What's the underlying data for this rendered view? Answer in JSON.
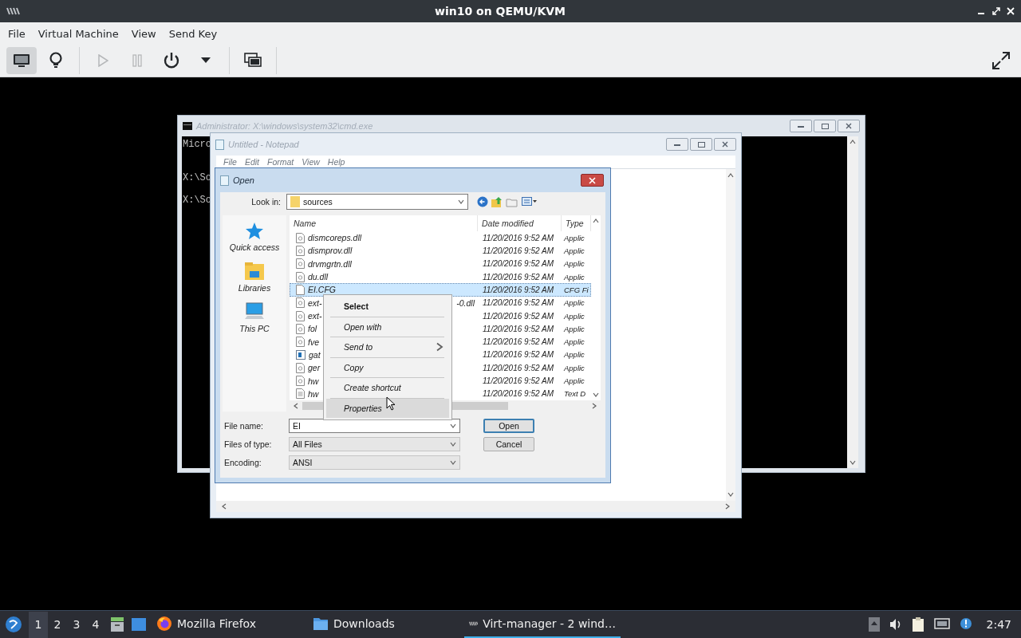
{
  "window": {
    "title": "win10 on QEMU/KVM"
  },
  "menu": [
    "File",
    "Virtual Machine",
    "View",
    "Send Key"
  ],
  "toolbar": [
    [
      {
        "kind": "monitor",
        "selected": true,
        "disabled": false
      },
      {
        "kind": "bulb",
        "selected": false,
        "disabled": false
      }
    ],
    [
      {
        "kind": "play",
        "selected": false,
        "disabled": true
      },
      {
        "kind": "pause",
        "selected": false,
        "disabled": true
      },
      {
        "kind": "power",
        "selected": false,
        "disabled": false
      },
      {
        "kind": "caret",
        "selected": false,
        "disabled": false
      }
    ],
    [
      {
        "kind": "screens",
        "selected": false,
        "disabled": false
      }
    ]
  ],
  "guest": {
    "cmd": {
      "title": "Administrator: X:\\windows\\system32\\cmd.exe",
      "lines": [
        "Micro",
        "X:\\So",
        "X:\\So"
      ]
    },
    "notepad": {
      "title": "Untitled - Notepad",
      "menu": [
        "File",
        "Edit",
        "Format",
        "View",
        "Help"
      ]
    },
    "dialog": {
      "title": "Open",
      "look_in": {
        "label": "Look in:",
        "value": "sources"
      },
      "places": [
        {
          "label": "Quick access",
          "kind": "star"
        },
        {
          "label": "Libraries",
          "kind": "library"
        },
        {
          "label": "This PC",
          "kind": "pc"
        }
      ],
      "columns": [
        "Name",
        "Date modified",
        "Type"
      ],
      "rows": [
        {
          "name": "dismcoreps.dll",
          "date": "11/20/2016 9:52 AM",
          "type": "Applic",
          "kind": "dll",
          "selected": false
        },
        {
          "name": "dismprov.dll",
          "date": "11/20/2016 9:52 AM",
          "type": "Applic",
          "kind": "dll",
          "selected": false
        },
        {
          "name": "drvmgrtn.dll",
          "date": "11/20/2016 9:52 AM",
          "type": "Applic",
          "kind": "dll",
          "selected": false
        },
        {
          "name": "du.dll",
          "date": "11/20/2016 9:52 AM",
          "type": "Applic",
          "kind": "dll",
          "selected": false
        },
        {
          "name": "EI.CFG",
          "date": "11/20/2016 9:52 AM",
          "type": "CFG Fi",
          "kind": "blank",
          "selected": true
        },
        {
          "name": "ext-",
          "tail": "-0.dll",
          "date": "11/20/2016 9:52 AM",
          "type": "Applic",
          "kind": "dll",
          "selected": false
        },
        {
          "name": "ext-",
          "date": "11/20/2016 9:52 AM",
          "type": "Applic",
          "kind": "dll",
          "selected": false
        },
        {
          "name": "fol",
          "date": "11/20/2016 9:52 AM",
          "type": "Applic",
          "kind": "dll",
          "selected": false
        },
        {
          "name": "fve",
          "date": "11/20/2016 9:52 AM",
          "type": "Applic",
          "kind": "dll",
          "selected": false
        },
        {
          "name": "gat",
          "date": "11/20/2016 9:52 AM",
          "type": "Applic",
          "kind": "app",
          "selected": false
        },
        {
          "name": "ger",
          "date": "11/20/2016 9:52 AM",
          "type": "Applic",
          "kind": "dll",
          "selected": false
        },
        {
          "name": "hw",
          "date": "11/20/2016 9:52 AM",
          "type": "Applic",
          "kind": "dll",
          "selected": false
        },
        {
          "name": "hw",
          "date": "11/20/2016 9:52 AM",
          "type": "Text D",
          "kind": "text",
          "selected": false
        }
      ],
      "fields": [
        {
          "label": "File name:",
          "value": "EI",
          "editable": true
        },
        {
          "label": "Files of type:",
          "value": "All Files",
          "editable": false
        },
        {
          "label": "Encoding:",
          "value": "ANSI",
          "editable": false
        }
      ],
      "buttons": [
        {
          "label": "Open",
          "default": true
        },
        {
          "label": "Cancel",
          "default": false
        }
      ]
    },
    "context_menu": [
      {
        "label": "Select",
        "bold": true,
        "submenu": false,
        "selected": false
      },
      {
        "label": "Open with",
        "bold": false,
        "submenu": false,
        "selected": false
      },
      {
        "label": "Send to",
        "bold": false,
        "submenu": true,
        "selected": false
      },
      {
        "label": "Copy",
        "bold": false,
        "submenu": false,
        "selected": false
      },
      {
        "label": "Create shortcut",
        "bold": false,
        "submenu": false,
        "selected": false
      },
      {
        "label": "Properties",
        "bold": false,
        "submenu": false,
        "selected": true
      }
    ]
  },
  "taskbar": {
    "workspaces": [
      {
        "label": "1",
        "selected": true
      },
      {
        "label": "2",
        "selected": false
      },
      {
        "label": "3",
        "selected": false
      },
      {
        "label": "4",
        "selected": false
      }
    ],
    "tasks": [
      {
        "label": "Mozilla Firefox",
        "kind": "firefox",
        "selected": false
      },
      {
        "label": "Downloads",
        "kind": "folder",
        "selected": false
      },
      {
        "label": "Virt-manager - 2 wind…",
        "kind": "virt",
        "selected": true
      }
    ],
    "clock": "2:47"
  }
}
